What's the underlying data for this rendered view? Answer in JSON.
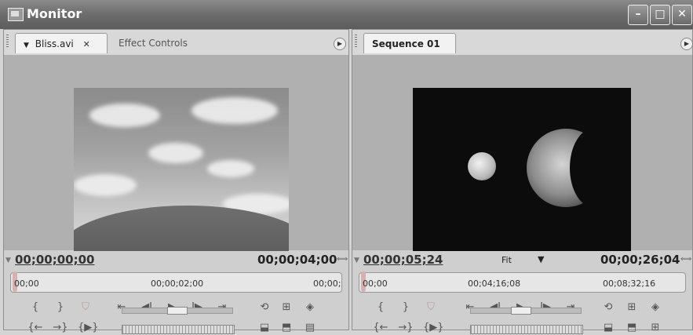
{
  "window": {
    "title": "Monitor"
  },
  "source": {
    "tabs": [
      {
        "label": "Bliss.avi",
        "close": "✕",
        "active": true
      },
      {
        "label": "Effect Controls",
        "active": false
      }
    ],
    "timecode_current": "00;00;00;00",
    "timecode_duration": "00;00;04;00",
    "ruler_labels": [
      "00;00",
      "00;00;02;00",
      "00;00;"
    ]
  },
  "program": {
    "tabs": [
      {
        "label": "Sequence 01",
        "close": "✕",
        "active": true
      }
    ],
    "timecode_current": "00;00;05;24",
    "zoom": "Fit",
    "timecode_duration": "00;00;26;04",
    "ruler_labels": [
      "00;00",
      "00;04;16;08",
      "00;08;32;16"
    ]
  },
  "icons": {
    "set_in": "{",
    "set_out": "}",
    "marker": "marker-icon",
    "goto_in": "{←",
    "goto_out": "→}",
    "play_in_out": "{▶}",
    "step_back": "◀I",
    "play": "▶",
    "step_forward": "I▶",
    "loop": "loop-icon",
    "safe_margins": "safe-margins-icon",
    "output": "output-icon"
  }
}
